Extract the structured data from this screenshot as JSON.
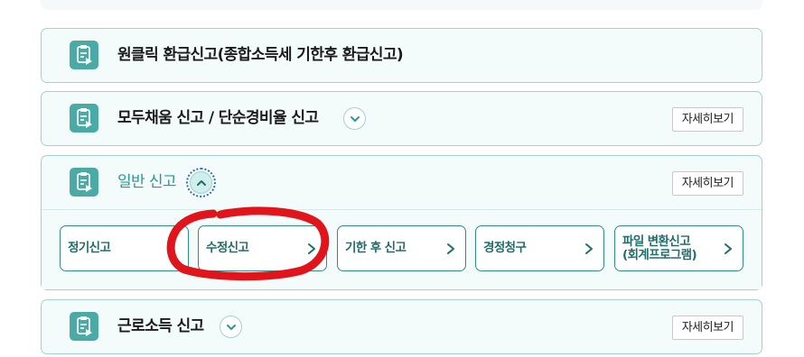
{
  "panels": [
    {
      "title": "원클릭 환급신고(종합소득세 기한후 환급신고)",
      "detail": ""
    },
    {
      "title": "모두채움 신고 / 단순경비율 신고",
      "detail": "자세히보기"
    },
    {
      "title": "일반 신고",
      "detail": "자세히보기",
      "items": [
        {
          "label": "정기신고"
        },
        {
          "label": "수정신고"
        },
        {
          "label": "기한 후 신고"
        },
        {
          "label": "경정청구"
        },
        {
          "label": "파일 변환신고\n(회계프로그램)"
        }
      ]
    },
    {
      "title": "근로소득 신고",
      "detail": "자세히보기"
    }
  ],
  "colors": {
    "accent": "#2c9892",
    "panel_bg": "#f3fbfb",
    "panel_border": "#9fd3d0",
    "annotation": "#e2141b"
  },
  "icons": {
    "panel_icon": "document-icon",
    "toggle_closed": "chevron-down-icon",
    "toggle_open": "chevron-up-icon",
    "item_arrow": "chevron-right-icon"
  }
}
